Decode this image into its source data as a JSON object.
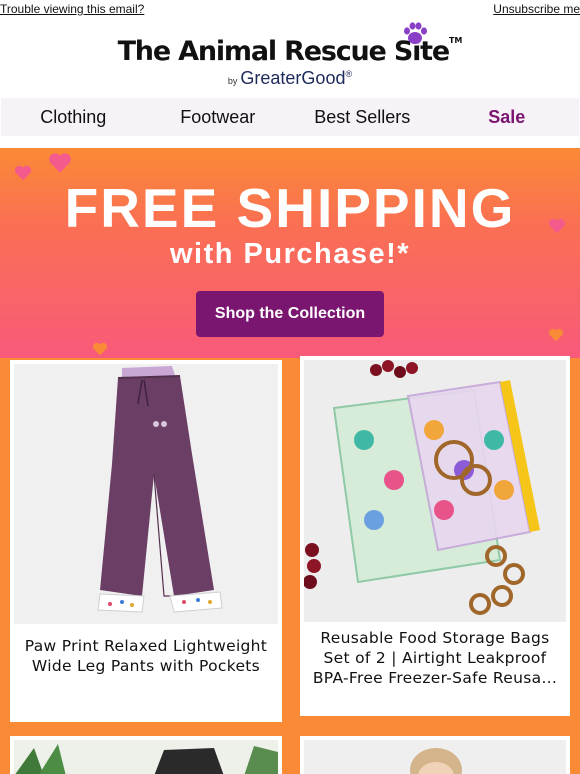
{
  "topbar": {
    "trouble_link": "Trouble viewing this email?",
    "unsubscribe_link": "Unsubscribe me"
  },
  "logo": {
    "title": "The Animal Rescue Site",
    "tm": "TM",
    "by": "by",
    "brand": "GreaterGood",
    "brand_mark": "®",
    "paw_color": "#8a3fc7"
  },
  "nav": {
    "items": [
      "Clothing",
      "Footwear",
      "Best Sellers"
    ],
    "sale": "Sale"
  },
  "hero": {
    "title": "FREE SHIPPING",
    "subtitle": "with Purchase!*",
    "cta": "Shop the Collection",
    "cta_color": "#7b1670"
  },
  "products": [
    {
      "caption_line1": "Paw Print Relaxed Lightweight",
      "caption_line2": "Wide Leg Pants with Pockets"
    },
    {
      "caption_line1": "Reusable Food Storage Bags",
      "caption_line2": "Set of 2 | Airtight Leakproof",
      "caption_line3": "BPA-Free  Freezer-Safe Reusa..."
    }
  ],
  "colors": {
    "accent": "#7b1670",
    "orange": "#fb8a36",
    "pink": "#f85a7a"
  }
}
